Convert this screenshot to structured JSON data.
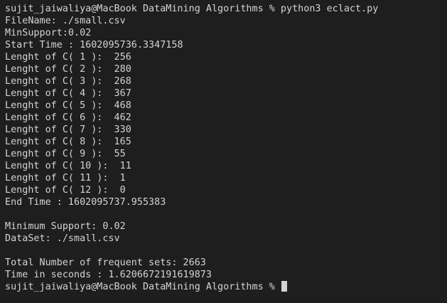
{
  "terminal": {
    "command_line": "sujit_jaiwaliya@MacBook DataMining Algorithms % python3 eclact.py",
    "lines": [
      "FileName: ./small.csv",
      "MinSupport:0.02",
      "Start Time : 1602095736.3347158",
      "Lenght of C( 1 ):  256",
      "Lenght of C( 2 ):  280",
      "Lenght of C( 3 ):  268",
      "Lenght of C( 4 ):  367",
      "Lenght of C( 5 ):  468",
      "Lenght of C( 6 ):  462",
      "Lenght of C( 7 ):  330",
      "Lenght of C( 8 ):  165",
      "Lenght of C( 9 ):  55",
      "Lenght of C( 10 ):  11",
      "Lenght of C( 11 ):  1",
      "Lenght of C( 12 ):  0",
      "End Time : 1602095737.955383",
      "",
      "Minimum Support: 0.02",
      "DataSet: ./small.csv",
      "",
      "Total Number of frequent sets: 2663",
      "Time in seconds : 1.6206672191619873"
    ],
    "prompt": "sujit_jaiwaliya@MacBook DataMining Algorithms % "
  }
}
